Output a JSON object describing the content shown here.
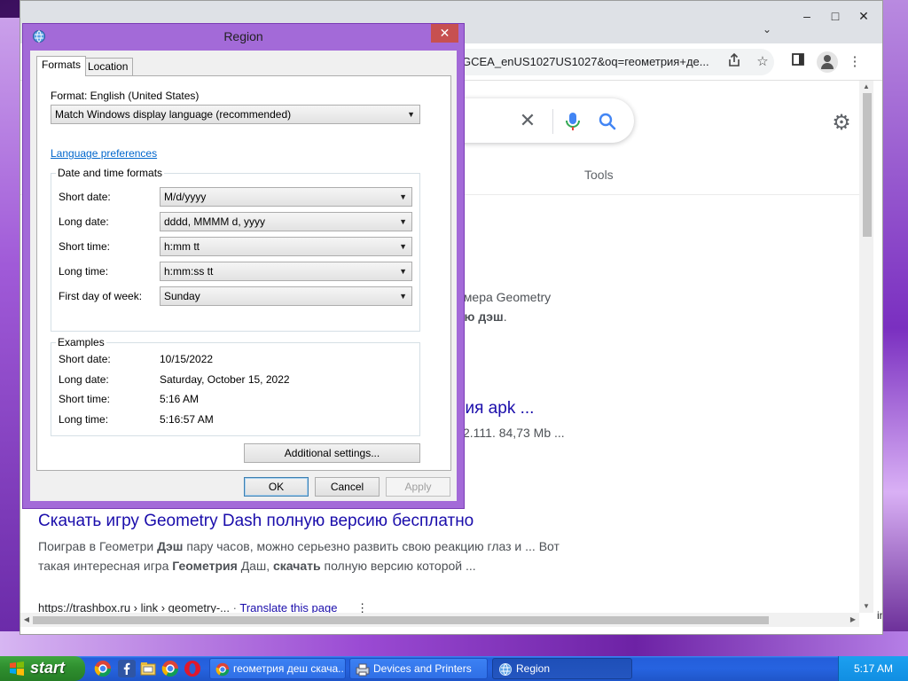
{
  "browser": {
    "url_text": "GCEA_enUS1027US1027&oq=геометрия+де...",
    "tools_label": "Tools",
    "win_controls": {
      "minimize": "–",
      "maximize": "□",
      "close": "✕"
    },
    "fragments": {
      "line1": "омера Geometry",
      "line2_bold": "ою дэш",
      "line2_end": ".",
      "link_fragment": "сия apk ...",
      "size_fragment": "v2.111. 84,73 Mb ..."
    },
    "result": {
      "title": "Скачать игру Geometry Dash полную версию бесплатно",
      "snippet1": {
        "a": "Поиграв в Геометри ",
        "b": "Дэш",
        "c": " пару часов, можно серьезно развить свою реакцию глаз и ... Вот"
      },
      "snippet2": {
        "a": "такая интересная игра ",
        "b": "Геометрия",
        "c": " Даш, ",
        "d": "скачать",
        "e": " полную версию которой ..."
      },
      "cite_url": "https://trashbox.ru › link › geometry-...",
      "cite_translate": "Translate this page",
      "cite_more": "⋮"
    },
    "edge_text": "in"
  },
  "dialog": {
    "title": "Region",
    "close": "✕",
    "tabs": [
      "Formats",
      "Location"
    ],
    "format_label": "Format: English (United States)",
    "format_value": "Match Windows display language (recommended)",
    "language_prefs_link": "Language preferences",
    "datetime_group_title": "Date and time formats",
    "datetime_rows": [
      {
        "label": "Short date:",
        "value": "M/d/yyyy"
      },
      {
        "label": "Long date:",
        "value": "dddd, MMMM d, yyyy"
      },
      {
        "label": "Short time:",
        "value": "h:mm tt"
      },
      {
        "label": "Long time:",
        "value": "h:mm:ss tt"
      },
      {
        "label": "First day of week:",
        "value": "Sunday"
      }
    ],
    "examples_group_title": "Examples",
    "examples": [
      {
        "label": "Short date:",
        "value": "10/15/2022"
      },
      {
        "label": "Long date:",
        "value": "Saturday, October 15, 2022"
      },
      {
        "label": "Short time:",
        "value": "5:16 AM"
      },
      {
        "label": "Long time:",
        "value": "5:16:57 AM"
      }
    ],
    "additional_settings": "Additional settings...",
    "ok": "OK",
    "cancel": "Cancel",
    "apply": "Apply"
  },
  "taskbar": {
    "start": "start",
    "items": [
      "геометрия деш скача...",
      "Devices and Printers",
      "Region"
    ],
    "clock": "5:17 AM"
  }
}
